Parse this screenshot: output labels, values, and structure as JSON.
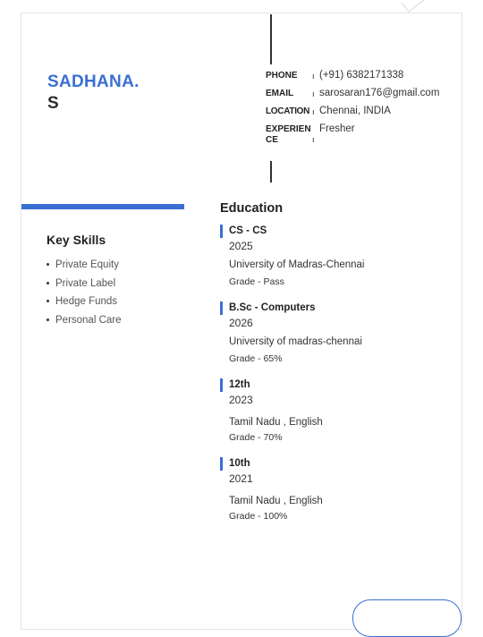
{
  "profile": {
    "first_name": "SADHANA.",
    "last_name": "S"
  },
  "contact": [
    {
      "label": "PHONE",
      "value": "(+91) 6382171338"
    },
    {
      "label": "EMAIL",
      "value": "sarosaran176@gmail.com"
    },
    {
      "label": "LOCATION",
      "value": "Chennai, INDIA"
    },
    {
      "label": "EXPERIENCE",
      "value": "Fresher"
    }
  ],
  "contact_separator": "ı",
  "skills": {
    "title": "Key Skills",
    "items": [
      "Private Equity",
      "Private Label",
      "Hedge Funds",
      "Personal Care"
    ]
  },
  "education": {
    "title": "Education",
    "entries": [
      {
        "degree": "CS - CS",
        "year": "2025",
        "institution": "University of Madras-Chennai",
        "grade": "Grade - Pass"
      },
      {
        "degree": "B.Sc - Computers",
        "year": "2026",
        "institution": "University of madras-chennai",
        "grade": "Grade - 65%"
      },
      {
        "degree": "12th",
        "year": "2023",
        "institution": "Tamil Nadu , English",
        "grade": "Grade - 70%"
      },
      {
        "degree": "10th",
        "year": "2021",
        "institution": "Tamil Nadu , English",
        "grade": "Grade - 100%"
      }
    ]
  },
  "colors": {
    "accent": "#3a6fd3",
    "text": "#333333"
  }
}
